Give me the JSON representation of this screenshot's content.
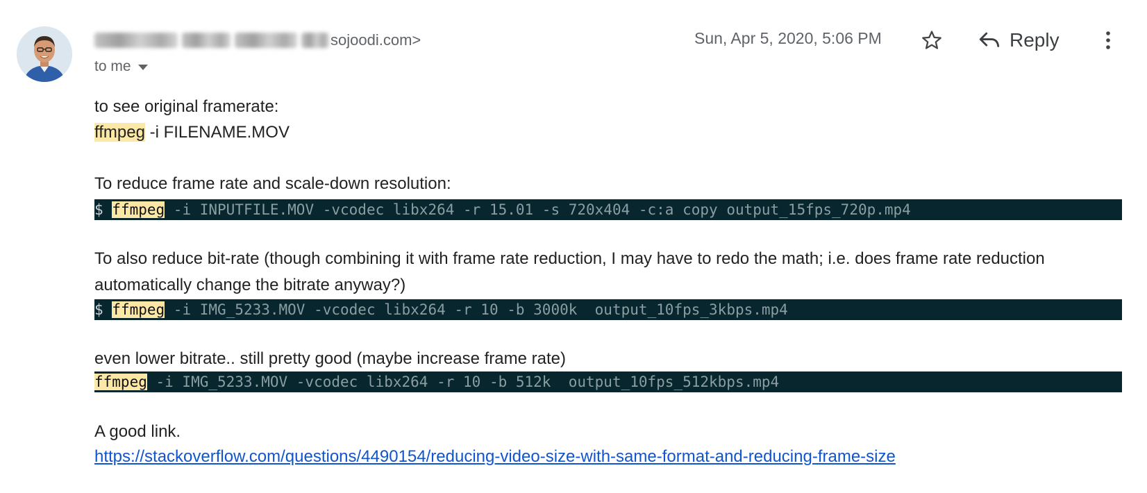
{
  "header": {
    "sender_domain": "sojoodi.com>",
    "recipient": "to me",
    "date": "Sun, Apr 5, 2020, 5:06 PM",
    "reply_label": "Reply"
  },
  "icons": {
    "avatar": "avatar",
    "star": "star-icon",
    "reply": "reply-arrow-icon",
    "more": "more-vert-icon",
    "dropdown": "caret-down-icon"
  },
  "colors": {
    "code_background": "#07262d",
    "highlight": "#fce8a6",
    "link": "#1155cc"
  },
  "body": {
    "line1": "to see original framerate:",
    "cmd1_highlight": "ffmpeg",
    "cmd1_rest": " -i FILENAME.MOV",
    "section2_label": "To reduce frame rate and scale-down resolution:",
    "code2_prompt": "$ ",
    "code2_highlight": "ffmpeg",
    "code2_rest": " -i INPUTFILE.MOV -vcodec libx264 -r 15.01 -s 720x404 -c:a copy output_15fps_720p.mp4",
    "section3_label": "To also reduce bit-rate (though combining it with frame rate reduction, I may have to redo the math; i.e. does frame rate reduction automatically change the bitrate anyway?)",
    "code3_prompt": "$ ",
    "code3_highlight": "ffmpeg",
    "code3_rest": " -i IMG_5233.MOV -vcodec libx264 -r 10 -b 3000k  output_10fps_3kbps.mp4",
    "section4_label": "even lower bitrate.. still pretty good (maybe increase frame rate)",
    "code4_highlight": "ffmpeg",
    "code4_rest": " -i IMG_5233.MOV -vcodec libx264 -r 10 -b 512k  output_10fps_512kbps.mp4",
    "section5_label": "A good link.",
    "link": "https://stackoverflow.com/questions/4490154/reducing-video-size-with-same-format-and-reducing-frame-size"
  }
}
